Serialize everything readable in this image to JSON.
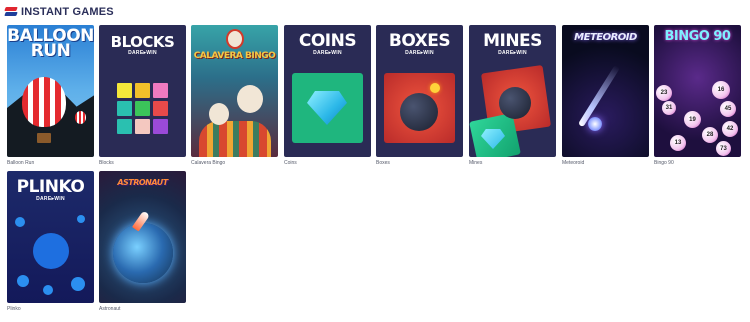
{
  "section": {
    "title": "INSTANT GAMES"
  },
  "games": [
    {
      "label": "Balloon Run",
      "art_title": "BALLOON RUN"
    },
    {
      "label": "Blocks",
      "art_title": "BLOCKS",
      "art_sub": "DARE▸WIN"
    },
    {
      "label": "Calavera Bingo",
      "art_title": "CALAVERA BINGO"
    },
    {
      "label": "Coins",
      "art_title": "COINS",
      "art_sub": "DARE▸WIN"
    },
    {
      "label": "Boxes",
      "art_title": "BOXES",
      "art_sub": "DARE▸WIN"
    },
    {
      "label": "Mines",
      "art_title": "MINES",
      "art_sub": "DARE▸WIN"
    },
    {
      "label": "Meteoroid",
      "art_title": "METEOROID"
    },
    {
      "label": "Bingo 90",
      "art_title": "BINGO 90",
      "balls": [
        "23",
        "16",
        "31",
        "19",
        "45",
        "28",
        "42",
        "13",
        "73"
      ]
    },
    {
      "label": "Plinko",
      "art_title": "PLINKO",
      "art_sub": "DARE▸WIN"
    },
    {
      "label": "Astronaut",
      "art_title": "ASTRONAUT"
    }
  ],
  "colors": {
    "title": "#2b2f5a",
    "label": "#555a6a",
    "tile_dark": "#2a2b55"
  },
  "icons": {
    "brand": "brand-stripes-icon"
  }
}
